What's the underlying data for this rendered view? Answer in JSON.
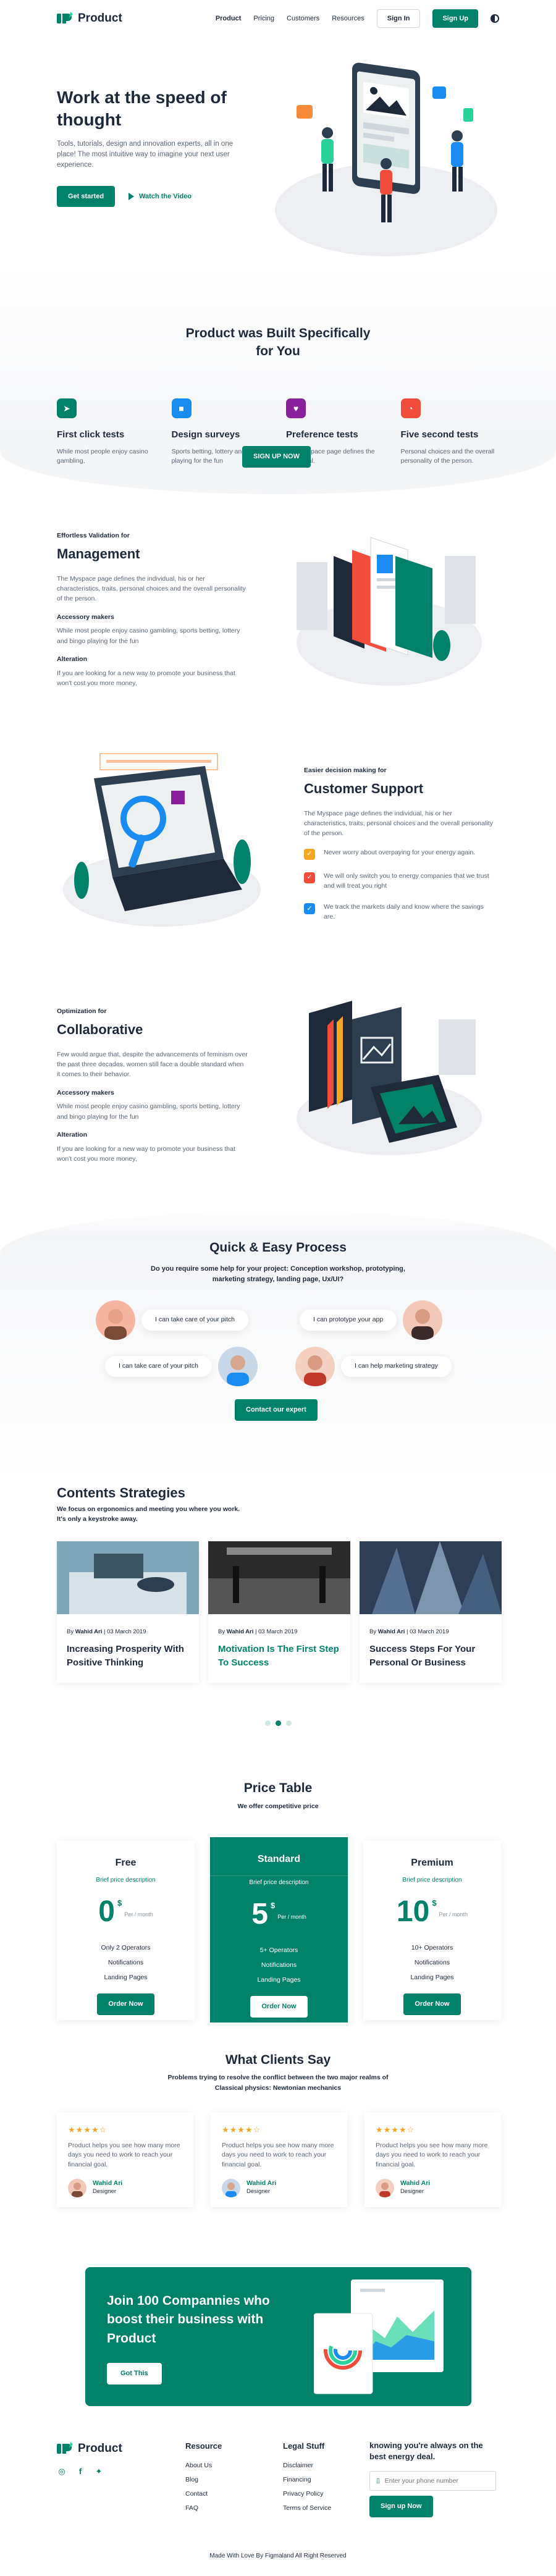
{
  "nav": {
    "brand": "Product",
    "links": [
      "Product",
      "Pricing",
      "Customers",
      "Resources"
    ],
    "signin": "Sign In",
    "signup": "Sign Up"
  },
  "hero": {
    "title": "Work at the speed of thought",
    "text": "Tools, tutorials, design and innovation experts, all in one place! The most intuitive way to imagine your next user experience.",
    "cta": "Get started",
    "watch": "Watch the Video"
  },
  "features": {
    "title": "Product  was Built Specifically for You",
    "items": [
      {
        "title": "First click tests",
        "text": "While most people enjoy casino gambling,",
        "icon": "pointer-icon",
        "color": "#00826a"
      },
      {
        "title": "Design surveys",
        "text": "Sports betting, lottery and bingo playing for the fun",
        "icon": "cube-icon",
        "color": "#1a8bf0"
      },
      {
        "title": "Preference tests",
        "text": "The Myspace page defines the individual.",
        "icon": "heart-icon",
        "color": "#8a1f9e"
      },
      {
        "title": "Five second tests",
        "text": "Personal choices and the overall personality of the person.",
        "icon": "timer-icon",
        "color": "#f24c3d"
      }
    ],
    "cta": "SIGN UP NOW"
  },
  "management": {
    "eyebrow": "Effortless Validation for",
    "title": "Management",
    "text": "The Myspace page defines the individual, his or her characteristics, traits, personal choices and the overall personality of the person.",
    "h1": "Accessory makers",
    "p1": "While most people enjoy casino gambling, sports betting, lottery and bingo playing for the fun",
    "h2": "Alteration",
    "p2": "If you are looking for a new way to promote your business that won't cost you more money,"
  },
  "support": {
    "eyebrow": "Easier decision making for",
    "title": "Customer Support",
    "text": "The Myspace page defines the individual, his or her characteristics, traits, personal choices and the overall personality of the person.",
    "items": [
      {
        "text": "Never worry about overpaying for your energy again.",
        "color": "#f5a623"
      },
      {
        "text": "We will only switch you to energy companies that we trust and will treat you right",
        "color": "#f24c3d"
      },
      {
        "text": "We track the markets daily and know where the savings are.",
        "color": "#1a8bf0"
      }
    ]
  },
  "collab": {
    "eyebrow": "Optimization for",
    "title": "Collaborative",
    "text": "Few would argue that, despite the advancements of feminism over the past three decades, women still face a double standard when it comes to their behavior.",
    "h1": "Accessory makers",
    "p1": "While most people enjoy casino gambling, sports betting, lottery and bingo playing for the fun",
    "h2": "Alteration",
    "p2": "If you are looking for a new way to promote your business that won't cost you more money,"
  },
  "process": {
    "title": "Quick & Easy Process",
    "sub": "Do you require some help for your project: Conception workshop, prototyping, marketing strategy, landing page, Ux/UI?",
    "b1": "I can take care of your pitch",
    "b2": "I can prototype your app",
    "b3": "I can take care of your pitch",
    "b4": "I can help marketing strategy",
    "cta": "Contact our expert"
  },
  "strategies": {
    "title": "Contents Strategies",
    "intro": "We focus on ergonomics and meeting you where you work. It's only a keystroke away.",
    "cards": [
      {
        "author": "Wahid Ari",
        "date": "03 March 2019",
        "title": "Increasing Prosperity With Positive Thinking"
      },
      {
        "author": "Wahid Ari",
        "date": "03 March 2019",
        "title": "Motivation Is The First Step To Success"
      },
      {
        "author": "Wahid Ari",
        "date": "03 March 2019",
        "title": "Success Steps For Your Personal Or Business"
      }
    ],
    "sep": "|"
  },
  "pricing": {
    "title": "Price Table",
    "sub": "We offer competitive price",
    "plans": [
      {
        "name": "Free",
        "desc": "Brief price description",
        "price": "0",
        "currency": "$",
        "per": "Per / month",
        "features": [
          "Only 2 Operators",
          "Notifications",
          "Landing Pages"
        ],
        "cta": "Order Now"
      },
      {
        "name": "Standard",
        "desc": "Brief price description",
        "price": "5",
        "currency": "$",
        "per": "Per / month",
        "features": [
          "5+ Operators",
          "Notifications",
          "Landing Pages"
        ],
        "cta": "Order Now"
      },
      {
        "name": "Premium",
        "desc": "Brief price description",
        "price": "10",
        "currency": "$",
        "per": "Per / month",
        "features": [
          "10+ Operators",
          "Notifications",
          "Landing Pages"
        ],
        "cta": "Order Now"
      }
    ]
  },
  "testimonials": {
    "title": "What Clients Say",
    "sub": "Problems trying to resolve the conflict between the two major realms of Classical physics: Newtonian mechanics",
    "items": [
      {
        "stars": "★★★★☆",
        "text": "Product helps you see how many more days you need to work to reach your financial goal.",
        "name": "Wahid Ari",
        "role": "Designer"
      },
      {
        "stars": "★★★★☆",
        "text": "Product helps you see how many more days you need to work to reach your financial goal.",
        "name": "Wahid Ari",
        "role": "Designer"
      },
      {
        "stars": "★★★★☆",
        "text": "Product helps you see how many more days you need to work to reach your financial goal.",
        "name": "Wahid Ari",
        "role": "Designer"
      }
    ]
  },
  "cta": {
    "title": "Join 100 Compannies who boost their business with Product",
    "button": "Got This"
  },
  "footer": {
    "brand": "Product",
    "resource_title": "Resource",
    "resource_links": [
      "About Us",
      "Blog",
      "Contact",
      "FAQ"
    ],
    "legal_title": "Legal Stuff",
    "legal_links": [
      "Disclaimer",
      "Financing",
      "Privacy Policy",
      "Terms of Service"
    ],
    "news_title": "knowing you're always on the best energy deal.",
    "phone_placeholder": "Enter your phone number",
    "signup": "Sign up Now",
    "copyright": "Made With Love By Figmaland All Right Reserved"
  }
}
